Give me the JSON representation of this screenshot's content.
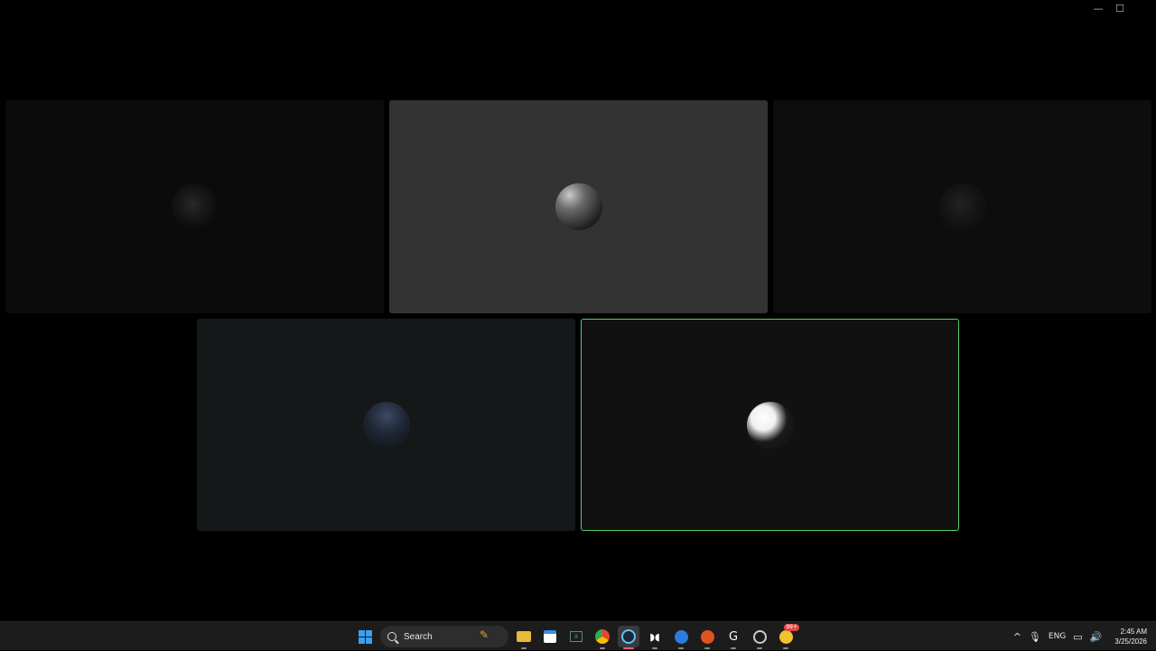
{
  "window": {
    "controls": {
      "minimize": "—",
      "maximize": "☐",
      "close": ""
    }
  },
  "tiles": [
    {
      "avatar": "knight-avatar"
    },
    {
      "avatar": "sword-knight-avatar"
    },
    {
      "avatar": "hooded-avatar"
    },
    {
      "avatar": "blue-knight-avatar"
    },
    {
      "avatar": "white-bust-avatar",
      "selected": true
    }
  ],
  "colors": {
    "selection_border": "#4fd06a",
    "windows_blue": "#3aa0f0"
  },
  "taskbar": {
    "search_placeholder": "Search",
    "apps": [
      "file-explorer-icon",
      "microsoft-store-icon",
      "excel-icon",
      "chrome-icon",
      "steam-icon",
      "app-icon",
      "copilot-icon",
      "game-launcher-icon",
      "logitech-icon",
      "ubisoft-icon",
      "notification-app-icon"
    ],
    "notification_badge": "99+",
    "tray": {
      "language": "ENG",
      "time": "2:45 AM",
      "date": "3/25/2026"
    }
  }
}
